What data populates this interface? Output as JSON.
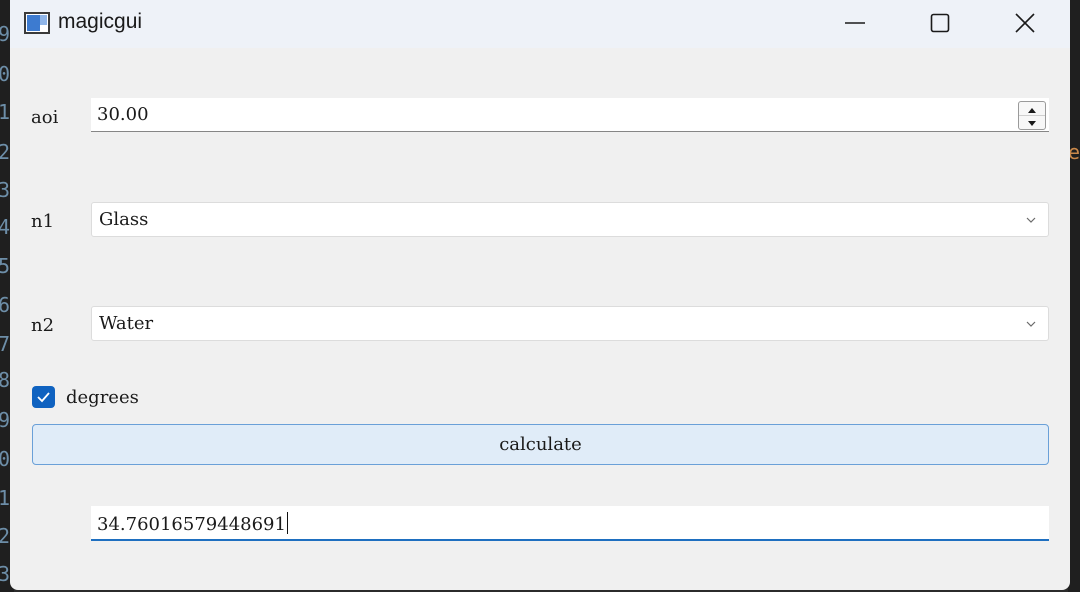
{
  "window": {
    "title": "magicgui",
    "icon": "app-window-icon",
    "controls": [
      "minimize-icon",
      "maximize-icon",
      "close-icon"
    ]
  },
  "fields": {
    "aoi": {
      "label": "aoi",
      "value": "30.00"
    },
    "n1": {
      "label": "n1",
      "value": "Glass"
    },
    "n2": {
      "label": "n2",
      "value": "Water"
    }
  },
  "degrees": {
    "label": "degrees",
    "checked": true
  },
  "calculate": {
    "label": "calculate"
  },
  "result": {
    "value": "34.76016579448691"
  },
  "colors": {
    "accent": "#0f62c0",
    "button_bg": "#e0ecf8",
    "button_border": "#6aa0d8",
    "window_bg": "#f0f0f0",
    "titlebar_bg": "#eef2f8"
  }
}
